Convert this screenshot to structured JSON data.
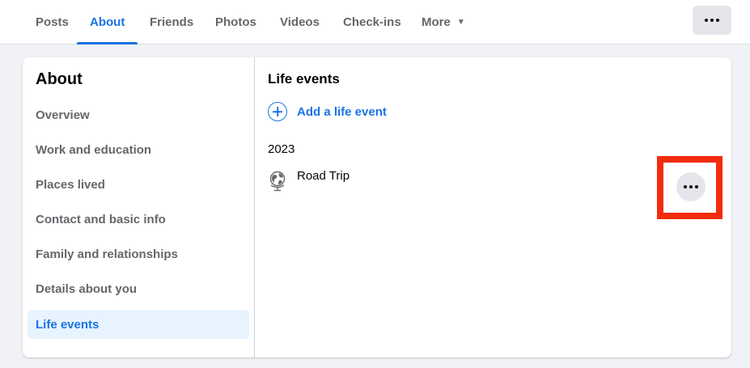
{
  "tabs": [
    {
      "label": "Posts"
    },
    {
      "label": "About"
    },
    {
      "label": "Friends"
    },
    {
      "label": "Photos"
    },
    {
      "label": "Videos"
    },
    {
      "label": "Check-ins"
    },
    {
      "label": "More"
    }
  ],
  "sidebar": {
    "title": "About",
    "items": [
      {
        "label": "Overview"
      },
      {
        "label": "Work and education"
      },
      {
        "label": "Places lived"
      },
      {
        "label": "Contact and basic info"
      },
      {
        "label": "Family and relationships"
      },
      {
        "label": "Details about you"
      },
      {
        "label": "Life events"
      }
    ]
  },
  "content": {
    "title": "Life events",
    "add_label": "Add a life event",
    "year": "2023",
    "event_title": "Road Trip"
  },
  "colors": {
    "accent": "#1b74e4",
    "highlight": "#f22b0c",
    "active_bg": "#e7f3ff"
  },
  "icons": {
    "more": "more-dots-icon",
    "dropdown": "caret-down-icon",
    "add": "plus-circle-icon",
    "event": "globe-icon"
  }
}
